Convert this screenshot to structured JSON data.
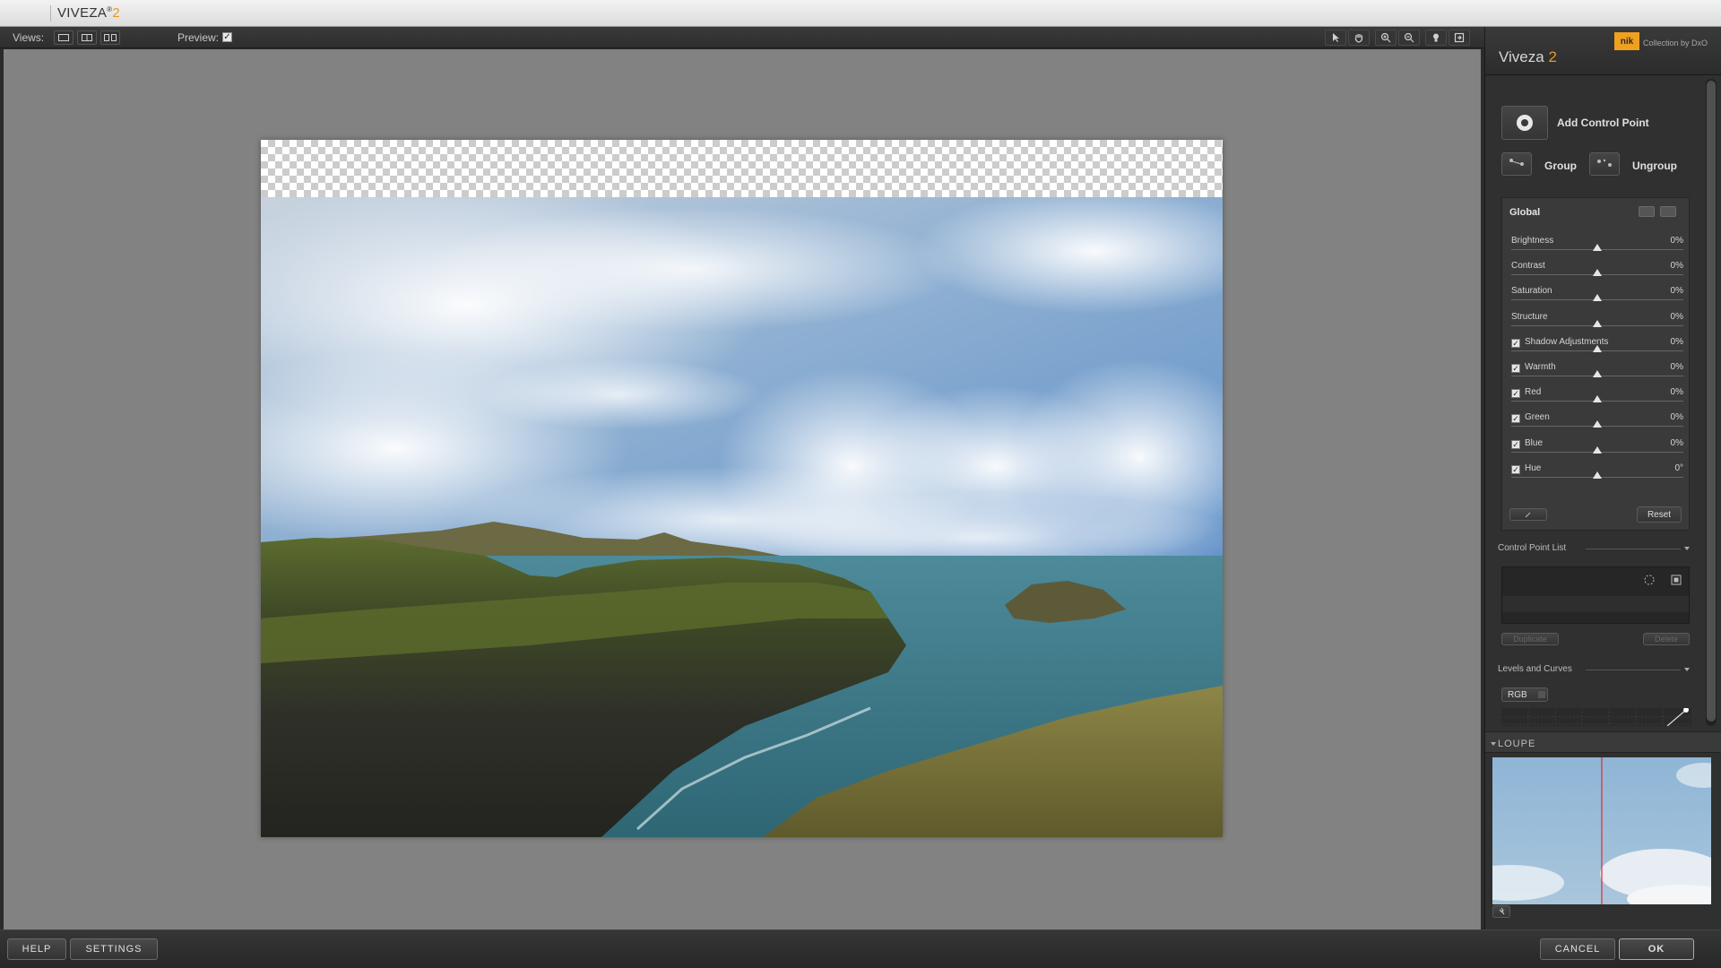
{
  "app": {
    "title": "VIVEZA",
    "title_reg": "®",
    "version": "2"
  },
  "toolbar": {
    "views_label": "Views:",
    "preview_label": "Preview:",
    "preview_checked": "✓"
  },
  "panel": {
    "title": "Viveza",
    "version": "2",
    "logo_text": "nik",
    "collection_text": "Collection by DxO",
    "add_control_point": "Add Control Point",
    "group": "Group",
    "ungroup": "Ungroup",
    "global": {
      "title": "Global",
      "sliders": [
        {
          "name": "Brightness",
          "value": "0%",
          "checkbox": false
        },
        {
          "name": "Contrast",
          "value": "0%",
          "checkbox": false
        },
        {
          "name": "Saturation",
          "value": "0%",
          "checkbox": false
        },
        {
          "name": "Structure",
          "value": "0%",
          "checkbox": false
        },
        {
          "name": "Shadow Adjustments",
          "value": "0%",
          "checkbox": true
        },
        {
          "name": "Warmth",
          "value": "0%",
          "checkbox": true
        },
        {
          "name": "Red",
          "value": "0%",
          "checkbox": true
        },
        {
          "name": "Green",
          "value": "0%",
          "checkbox": true
        },
        {
          "name": "Blue",
          "value": "0%",
          "checkbox": true
        },
        {
          "name": "Hue",
          "value": "0°",
          "checkbox": true
        }
      ],
      "reset": "Reset"
    },
    "control_point_list": "Control Point List",
    "duplicate": "Duplicate",
    "delete": "Delete",
    "levels_curves": "Levels and Curves",
    "channel": "RGB",
    "loupe": "LOUPE"
  },
  "bottom": {
    "help": "HELP",
    "settings": "SETTINGS",
    "cancel": "CANCEL",
    "ok": "OK"
  }
}
